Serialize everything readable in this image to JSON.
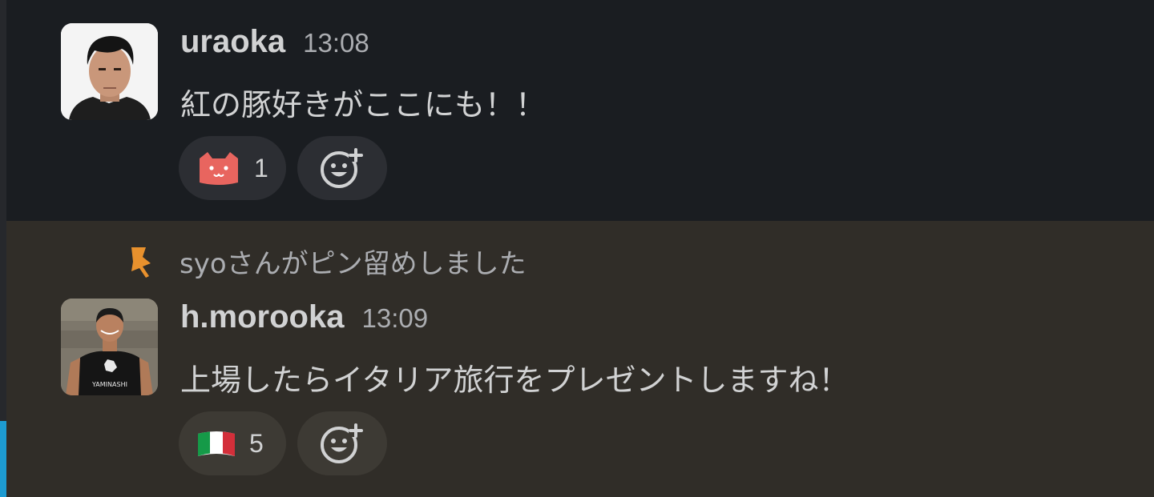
{
  "messages": [
    {
      "username": "uraoka",
      "time": "13:08",
      "text": "紅の豚好きがここにも！！",
      "reaction": {
        "emoji": "cat-face-emoji",
        "count": "1"
      }
    },
    {
      "pinned_note": "syoさんがピン留めしました",
      "username": "h.morooka",
      "time": "13:09",
      "text": "上場したらイタリア旅行をプレゼントしますね！",
      "reaction": {
        "emoji": "italy-flag-emoji",
        "count": "5"
      },
      "avatar_shirt_text": "YAMINASHI"
    }
  ],
  "colors": {
    "background_default": "#1a1d21",
    "background_pinned": "#302d28",
    "pin_icon": "#e8912d",
    "accent": "#1d9bd1",
    "cat_emoji": "#e8655f"
  }
}
